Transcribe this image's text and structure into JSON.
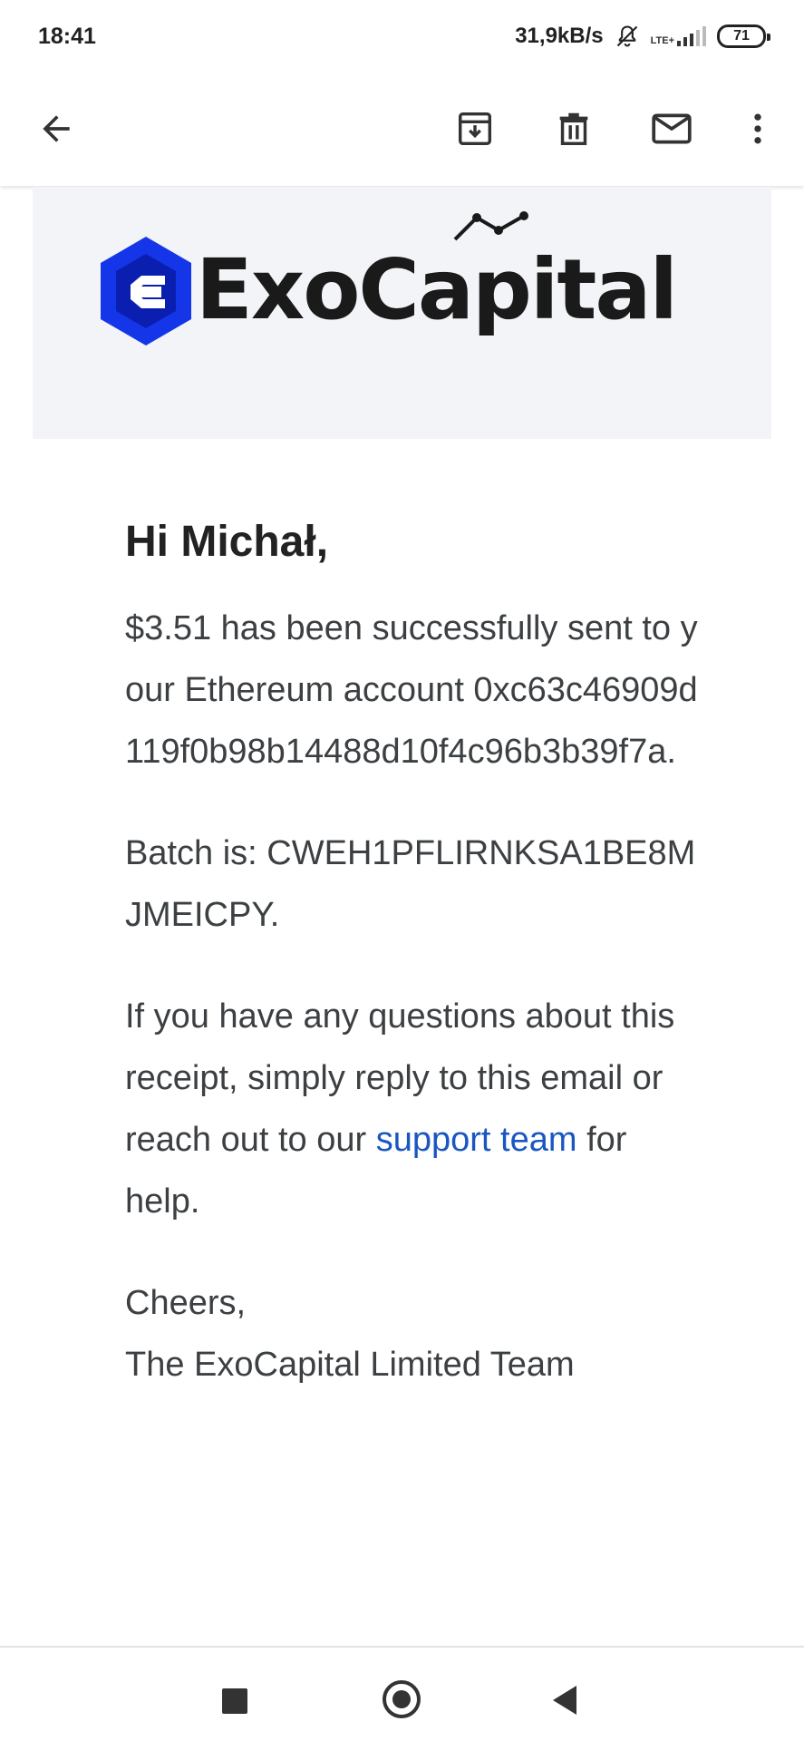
{
  "status_bar": {
    "time": "18:41",
    "network_speed": "31,9kB/s",
    "network_type": "LTE+",
    "battery": "71"
  },
  "app_bar": {
    "icons": [
      "back-arrow-icon",
      "archive-icon",
      "delete-icon",
      "mark-unread-icon",
      "more-vert-icon"
    ]
  },
  "email": {
    "brand": {
      "name": "ExoCapital",
      "colors": {
        "logo_blue": "#1436e8",
        "text": "#1a1a1a",
        "banner_bg": "#f2f4f7"
      }
    },
    "greeting": "Hi Michał,",
    "paragraph1": "$3.51 has been successfully sent to your Ethereum account 0xc63c46909d119f0b98b14488d10f4c96b3b39f7a.",
    "paragraph2": "Batch is: CWEH1PFLIRNKSA1BE8MJMEICPY.",
    "paragraph3_before": "If you have any questions about this receipt, simply reply to this email or reach out to our ",
    "paragraph3_link": "support team",
    "paragraph3_after": " for help.",
    "sign_off": "Cheers,",
    "signature": "The ExoCapital Limited Team"
  },
  "nav_bar": {
    "icons": [
      "recents-icon",
      "home-icon",
      "back-icon"
    ]
  },
  "colors": {
    "link": "#1a56c2",
    "body_text": "#3c4043"
  }
}
